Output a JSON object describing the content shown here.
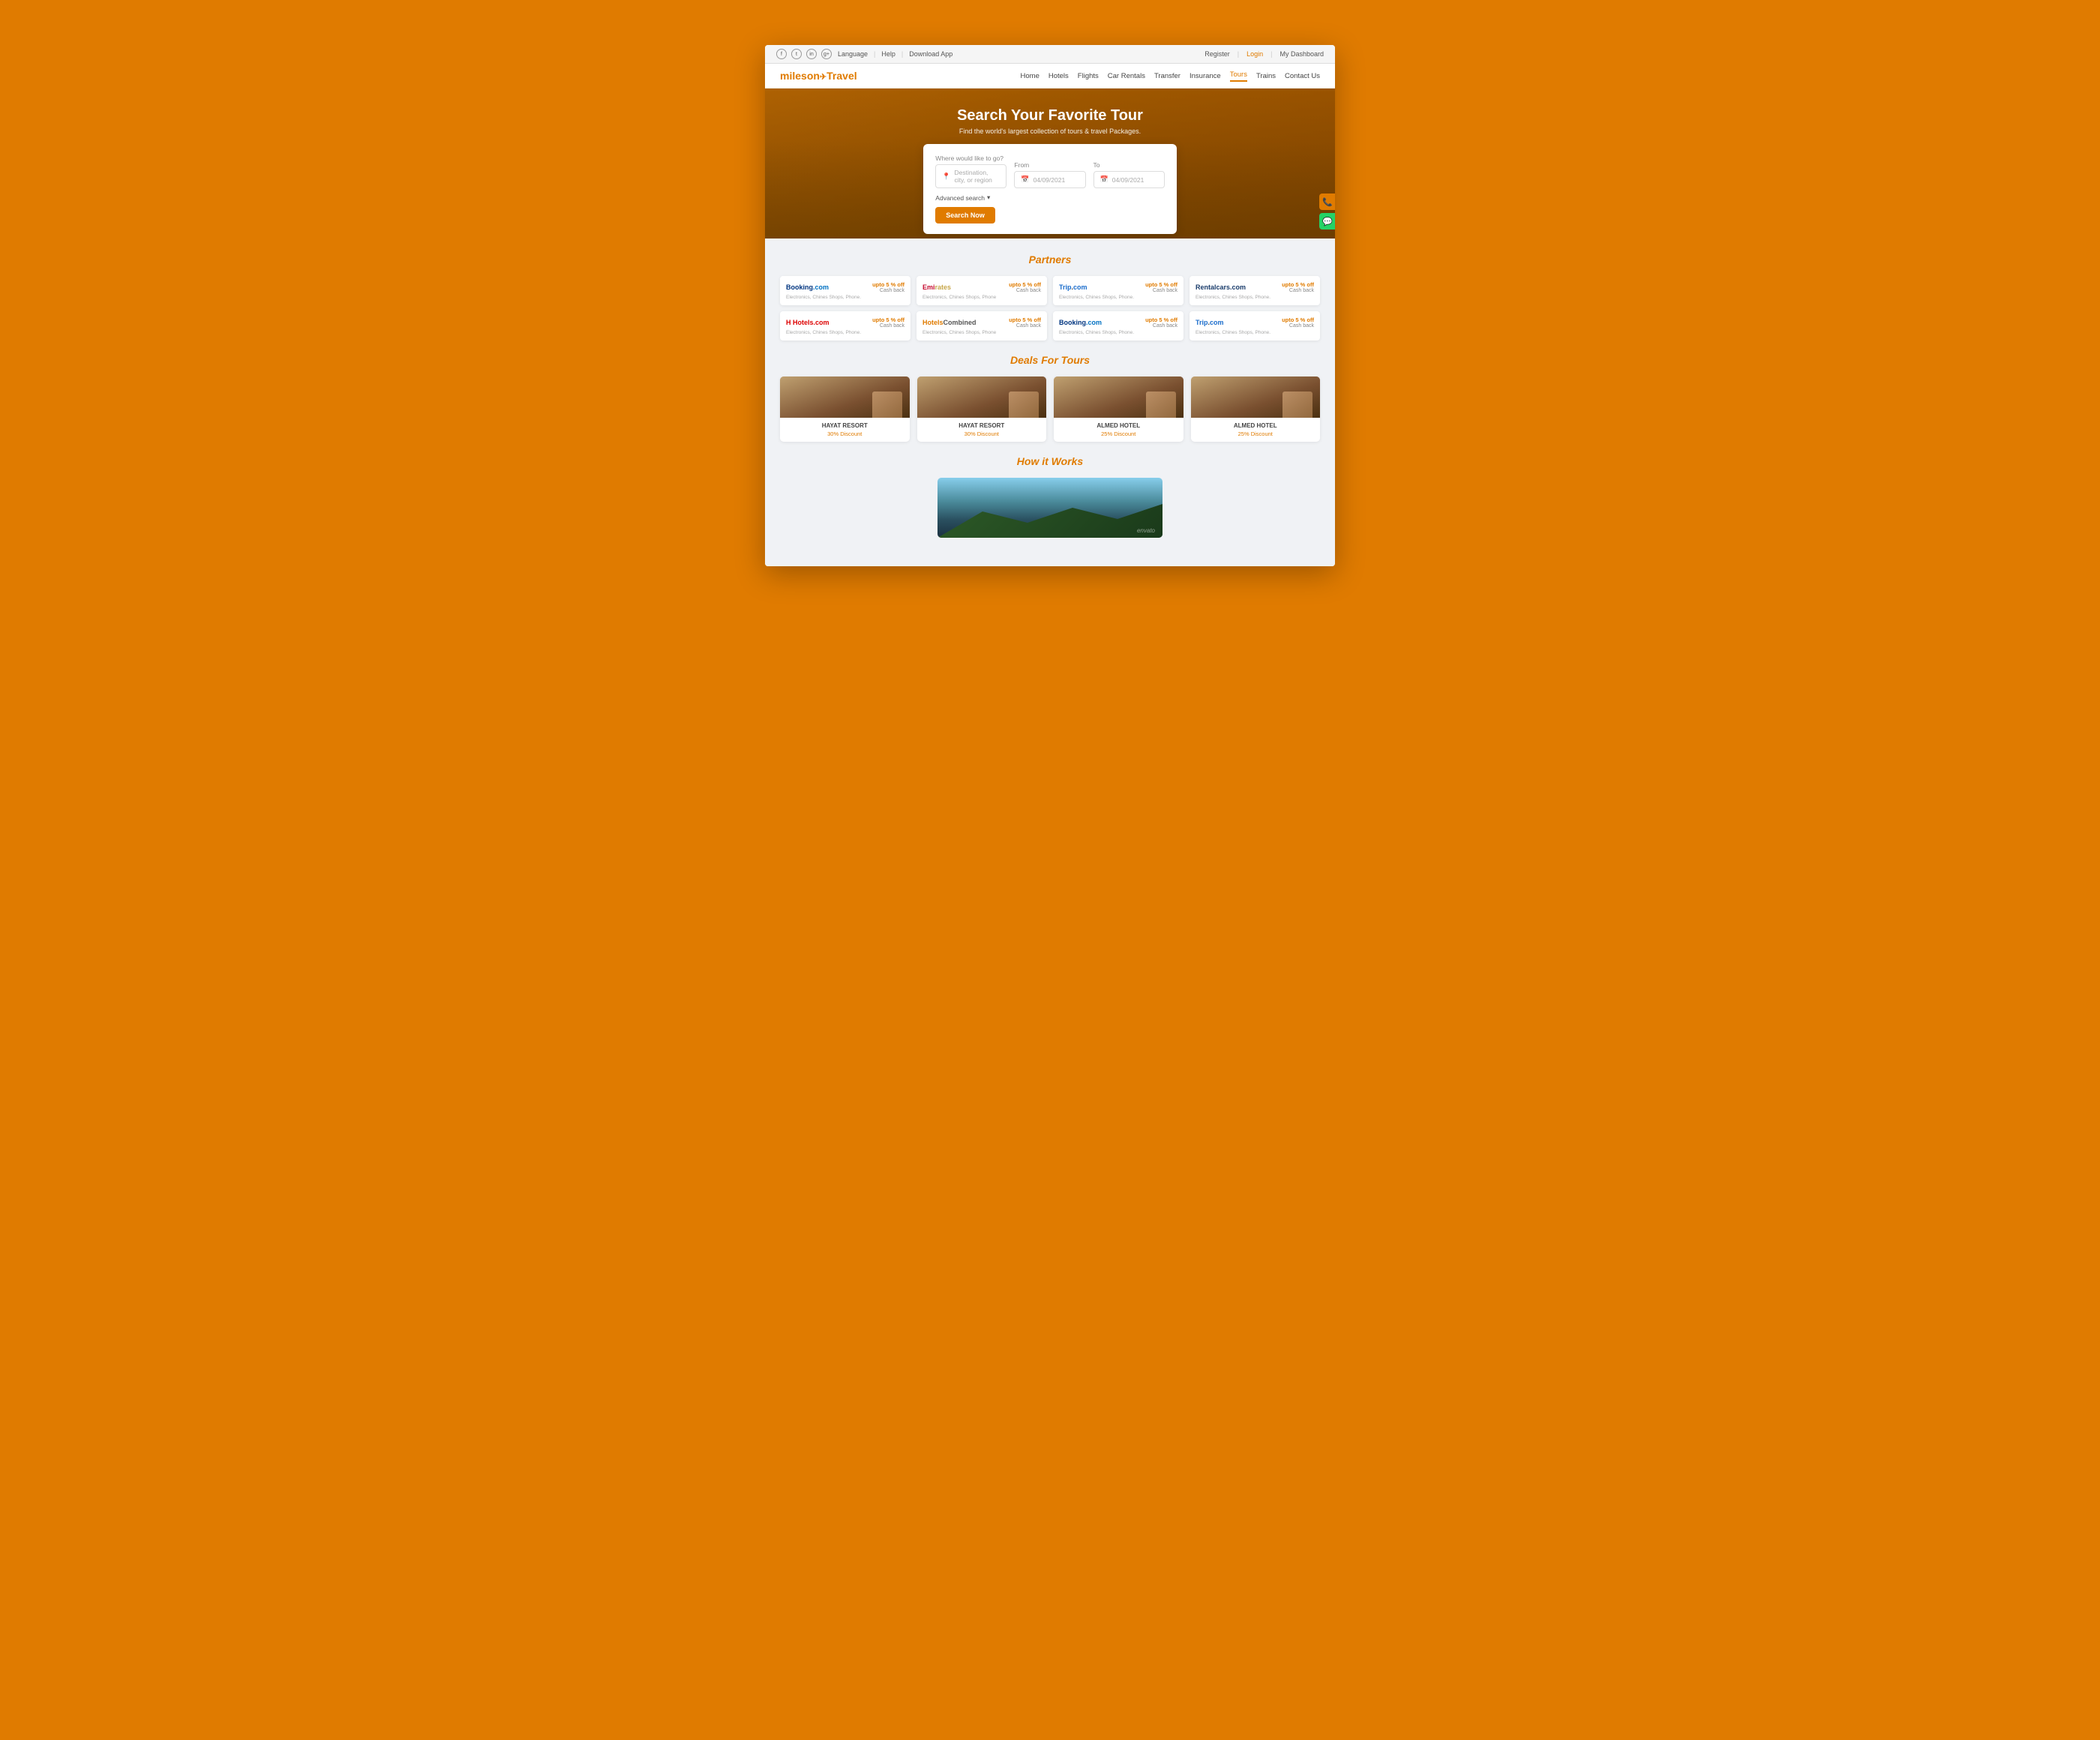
{
  "topbar": {
    "social": [
      "f",
      "t",
      "in",
      "g+"
    ],
    "language": "Language",
    "help": "Help",
    "download": "Download App",
    "register": "Register",
    "login": "Login",
    "dashboard": "My Dashboard"
  },
  "nav": {
    "logo_text1": "miles",
    "logo_text2": "on",
    "logo_text3": "Travel",
    "links": [
      {
        "label": "Home",
        "active": false
      },
      {
        "label": "Hotels",
        "active": false
      },
      {
        "label": "Flights",
        "active": false
      },
      {
        "label": "Car Rentals",
        "active": false
      },
      {
        "label": "Transfer",
        "active": false
      },
      {
        "label": "Insurance",
        "active": false
      },
      {
        "label": "Tours",
        "active": true
      },
      {
        "label": "Trains",
        "active": false
      },
      {
        "label": "Contact Us",
        "active": false
      }
    ]
  },
  "hero": {
    "title": "Search Your Favorite Tour",
    "subtitle": "Find the world's largest collection of tours & travel Packages."
  },
  "search": {
    "where_label": "Where would like to go?",
    "where_placeholder": "Destination, city, or region",
    "from_label": "From",
    "from_value": "04/09/2021",
    "to_label": "To",
    "to_value": "04/09/2021",
    "advanced_label": "Advanced search",
    "search_btn": "Search Now"
  },
  "partners": {
    "title": "Partners",
    "row1": [
      {
        "logo": "Booking.com",
        "discount": "upto 5 % off",
        "cashback": "Cash back",
        "desc": "Electronics, Chines Shops, Phone."
      },
      {
        "logo": "Emirates",
        "discount": "upto 5 % off",
        "cashback": "Cash back",
        "desc": "Electronics, Chines Shops, Phone"
      },
      {
        "logo": "Trip.com",
        "discount": "upto 5 % off",
        "cashback": "Cash back",
        "desc": "Electronics, Chines Shops, Phone."
      },
      {
        "logo": "Rentalcars.com",
        "discount": "upto 5 % off",
        "cashback": "Cash back",
        "desc": "Electronics, Chines Shops, Phone."
      }
    ],
    "row2": [
      {
        "logo": "Hotels.com",
        "discount": "upto 5 % off",
        "cashback": "Cash back",
        "desc": "Electronics, Chines Shops, Phone."
      },
      {
        "logo": "HotelsCombined",
        "discount": "upto 5 % off",
        "cashback": "Cash back",
        "desc": "Electronics, Chines Shops, Phone"
      },
      {
        "logo": "Booking.com",
        "discount": "upto 5 % off",
        "cashback": "Cash back",
        "desc": "Electronics, Chines Shops, Phone."
      },
      {
        "logo": "Trip.com",
        "discount": "upto 5 % off",
        "cashback": "Cash back",
        "desc": "Electronics, Chines Shops, Phone."
      }
    ]
  },
  "deals": {
    "title": "Deals For Tours",
    "items": [
      {
        "name": "HAYAT RESORT",
        "discount": "30% Discount"
      },
      {
        "name": "HAYAT RESORT",
        "discount": "30% Discount"
      },
      {
        "name": "ALMED HOTEL",
        "discount": "25% Discount"
      },
      {
        "name": "ALMED HOTEL",
        "discount": "25% Discount"
      }
    ]
  },
  "howworks": {
    "title": "How it Works",
    "watermark": "envato"
  }
}
